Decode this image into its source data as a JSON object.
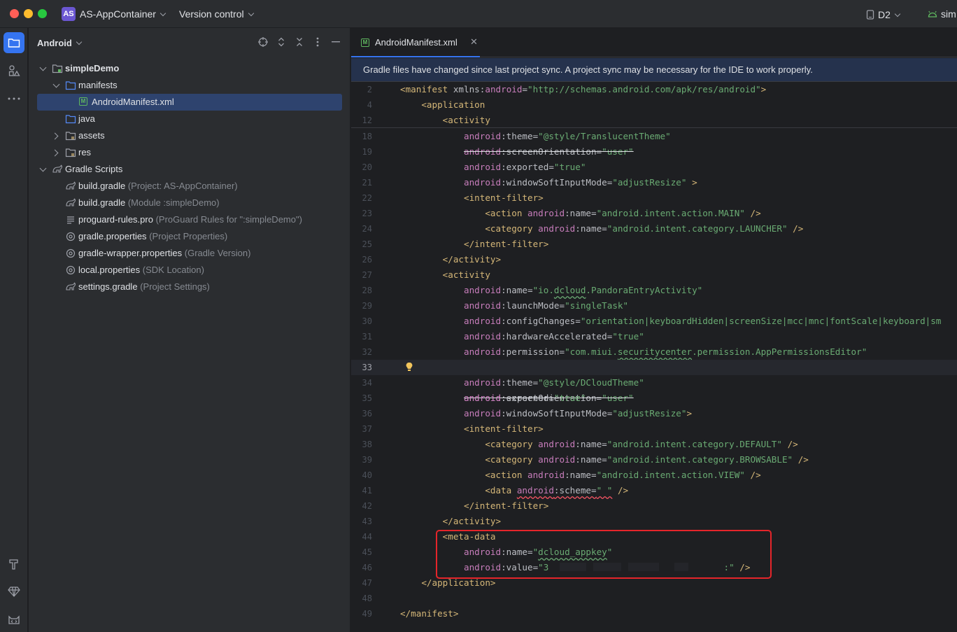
{
  "titlebar": {
    "project_badge": "AS",
    "project_name": "AS-AppContainer",
    "vcs": "Version control",
    "device": "D2",
    "run_config": "sim"
  },
  "project_panel": {
    "view": "Android",
    "tree": [
      {
        "label": "simpleDemo",
        "hint": ""
      },
      {
        "label": "manifests",
        "hint": ""
      },
      {
        "label": "AndroidManifest.xml",
        "hint": ""
      },
      {
        "label": "java",
        "hint": ""
      },
      {
        "label": "assets",
        "hint": ""
      },
      {
        "label": "res",
        "hint": ""
      },
      {
        "label": "Gradle Scripts",
        "hint": ""
      },
      {
        "label": "build.gradle",
        "hint": "(Project: AS-AppContainer)"
      },
      {
        "label": "build.gradle",
        "hint": "(Module :simpleDemo)"
      },
      {
        "label": "proguard-rules.pro",
        "hint": "(ProGuard Rules for \":simpleDemo\")"
      },
      {
        "label": "gradle.properties",
        "hint": "(Project Properties)"
      },
      {
        "label": "gradle-wrapper.properties",
        "hint": "(Gradle Version)"
      },
      {
        "label": "local.properties",
        "hint": "(SDK Location)"
      },
      {
        "label": "settings.gradle",
        "hint": "(Project Settings)"
      }
    ]
  },
  "editor": {
    "tab": "AndroidManifest.xml",
    "banner": "Gradle files have changed since last project sync. A project sync may be necessary for the IDE to work properly.",
    "line_numbers": [
      "2",
      "4",
      "12",
      "18",
      "19",
      "20",
      "21",
      "22",
      "23",
      "24",
      "25",
      "26",
      "27",
      "28",
      "29",
      "30",
      "31",
      "32",
      "33",
      "34",
      "35",
      "36",
      "37",
      "38",
      "39",
      "40",
      "41",
      "42",
      "43",
      "44",
      "45",
      "46",
      "47",
      "48",
      "49"
    ]
  },
  "colors": {
    "accent": "#3574f0",
    "highlight_box": "#e5252a",
    "tag": "#d5b778",
    "attr_ns": "#c77dbb",
    "string": "#6aab73"
  }
}
